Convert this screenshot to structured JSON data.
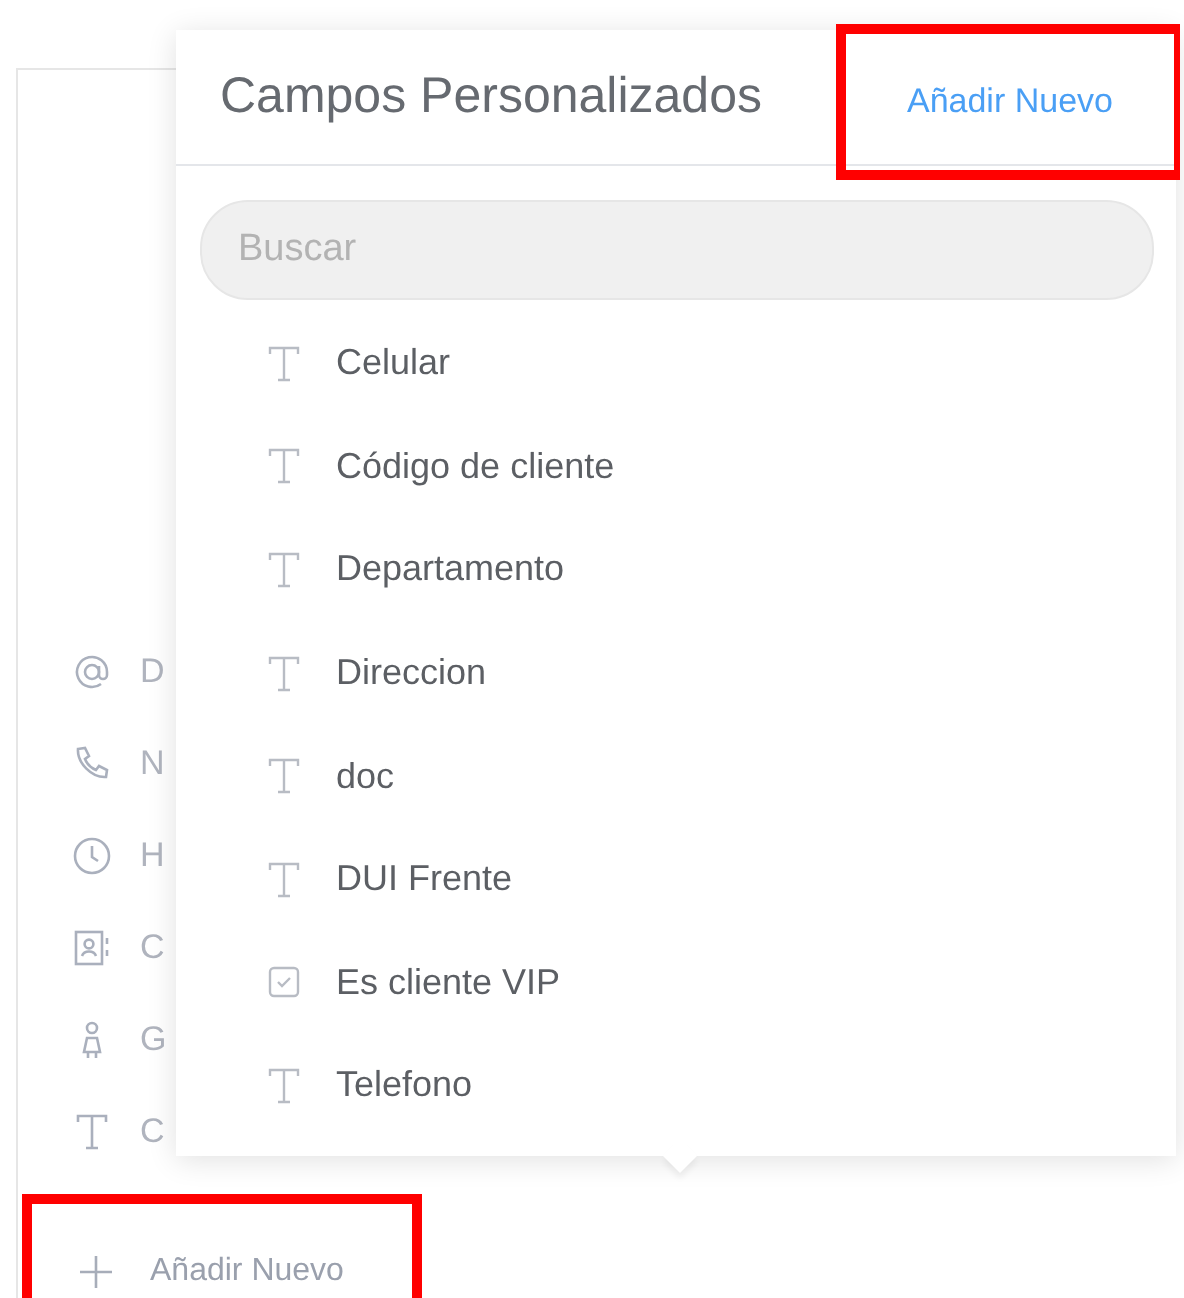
{
  "sidebar": {
    "items": [
      {
        "kind": "email",
        "label": "D"
      },
      {
        "kind": "phone",
        "label": "N"
      },
      {
        "kind": "clock",
        "label": "H"
      },
      {
        "kind": "contact",
        "label": "C"
      },
      {
        "kind": "person",
        "label": "G"
      },
      {
        "kind": "text",
        "label": "C"
      }
    ],
    "add_button": {
      "label": "Añadir Nuevo"
    }
  },
  "popover": {
    "title": "Campos Personalizados",
    "add_link": "Añadir Nuevo",
    "search": {
      "placeholder": "Buscar"
    },
    "fields": [
      {
        "kind": "text",
        "label": "Celular"
      },
      {
        "kind": "text",
        "label": "Código de cliente"
      },
      {
        "kind": "text",
        "label": "Departamento"
      },
      {
        "kind": "text",
        "label": "Direccion"
      },
      {
        "kind": "text",
        "label": "doc"
      },
      {
        "kind": "text",
        "label": "DUI Frente"
      },
      {
        "kind": "checkbox",
        "label": "Es cliente VIP"
      },
      {
        "kind": "text",
        "label": "Telefono"
      }
    ]
  }
}
